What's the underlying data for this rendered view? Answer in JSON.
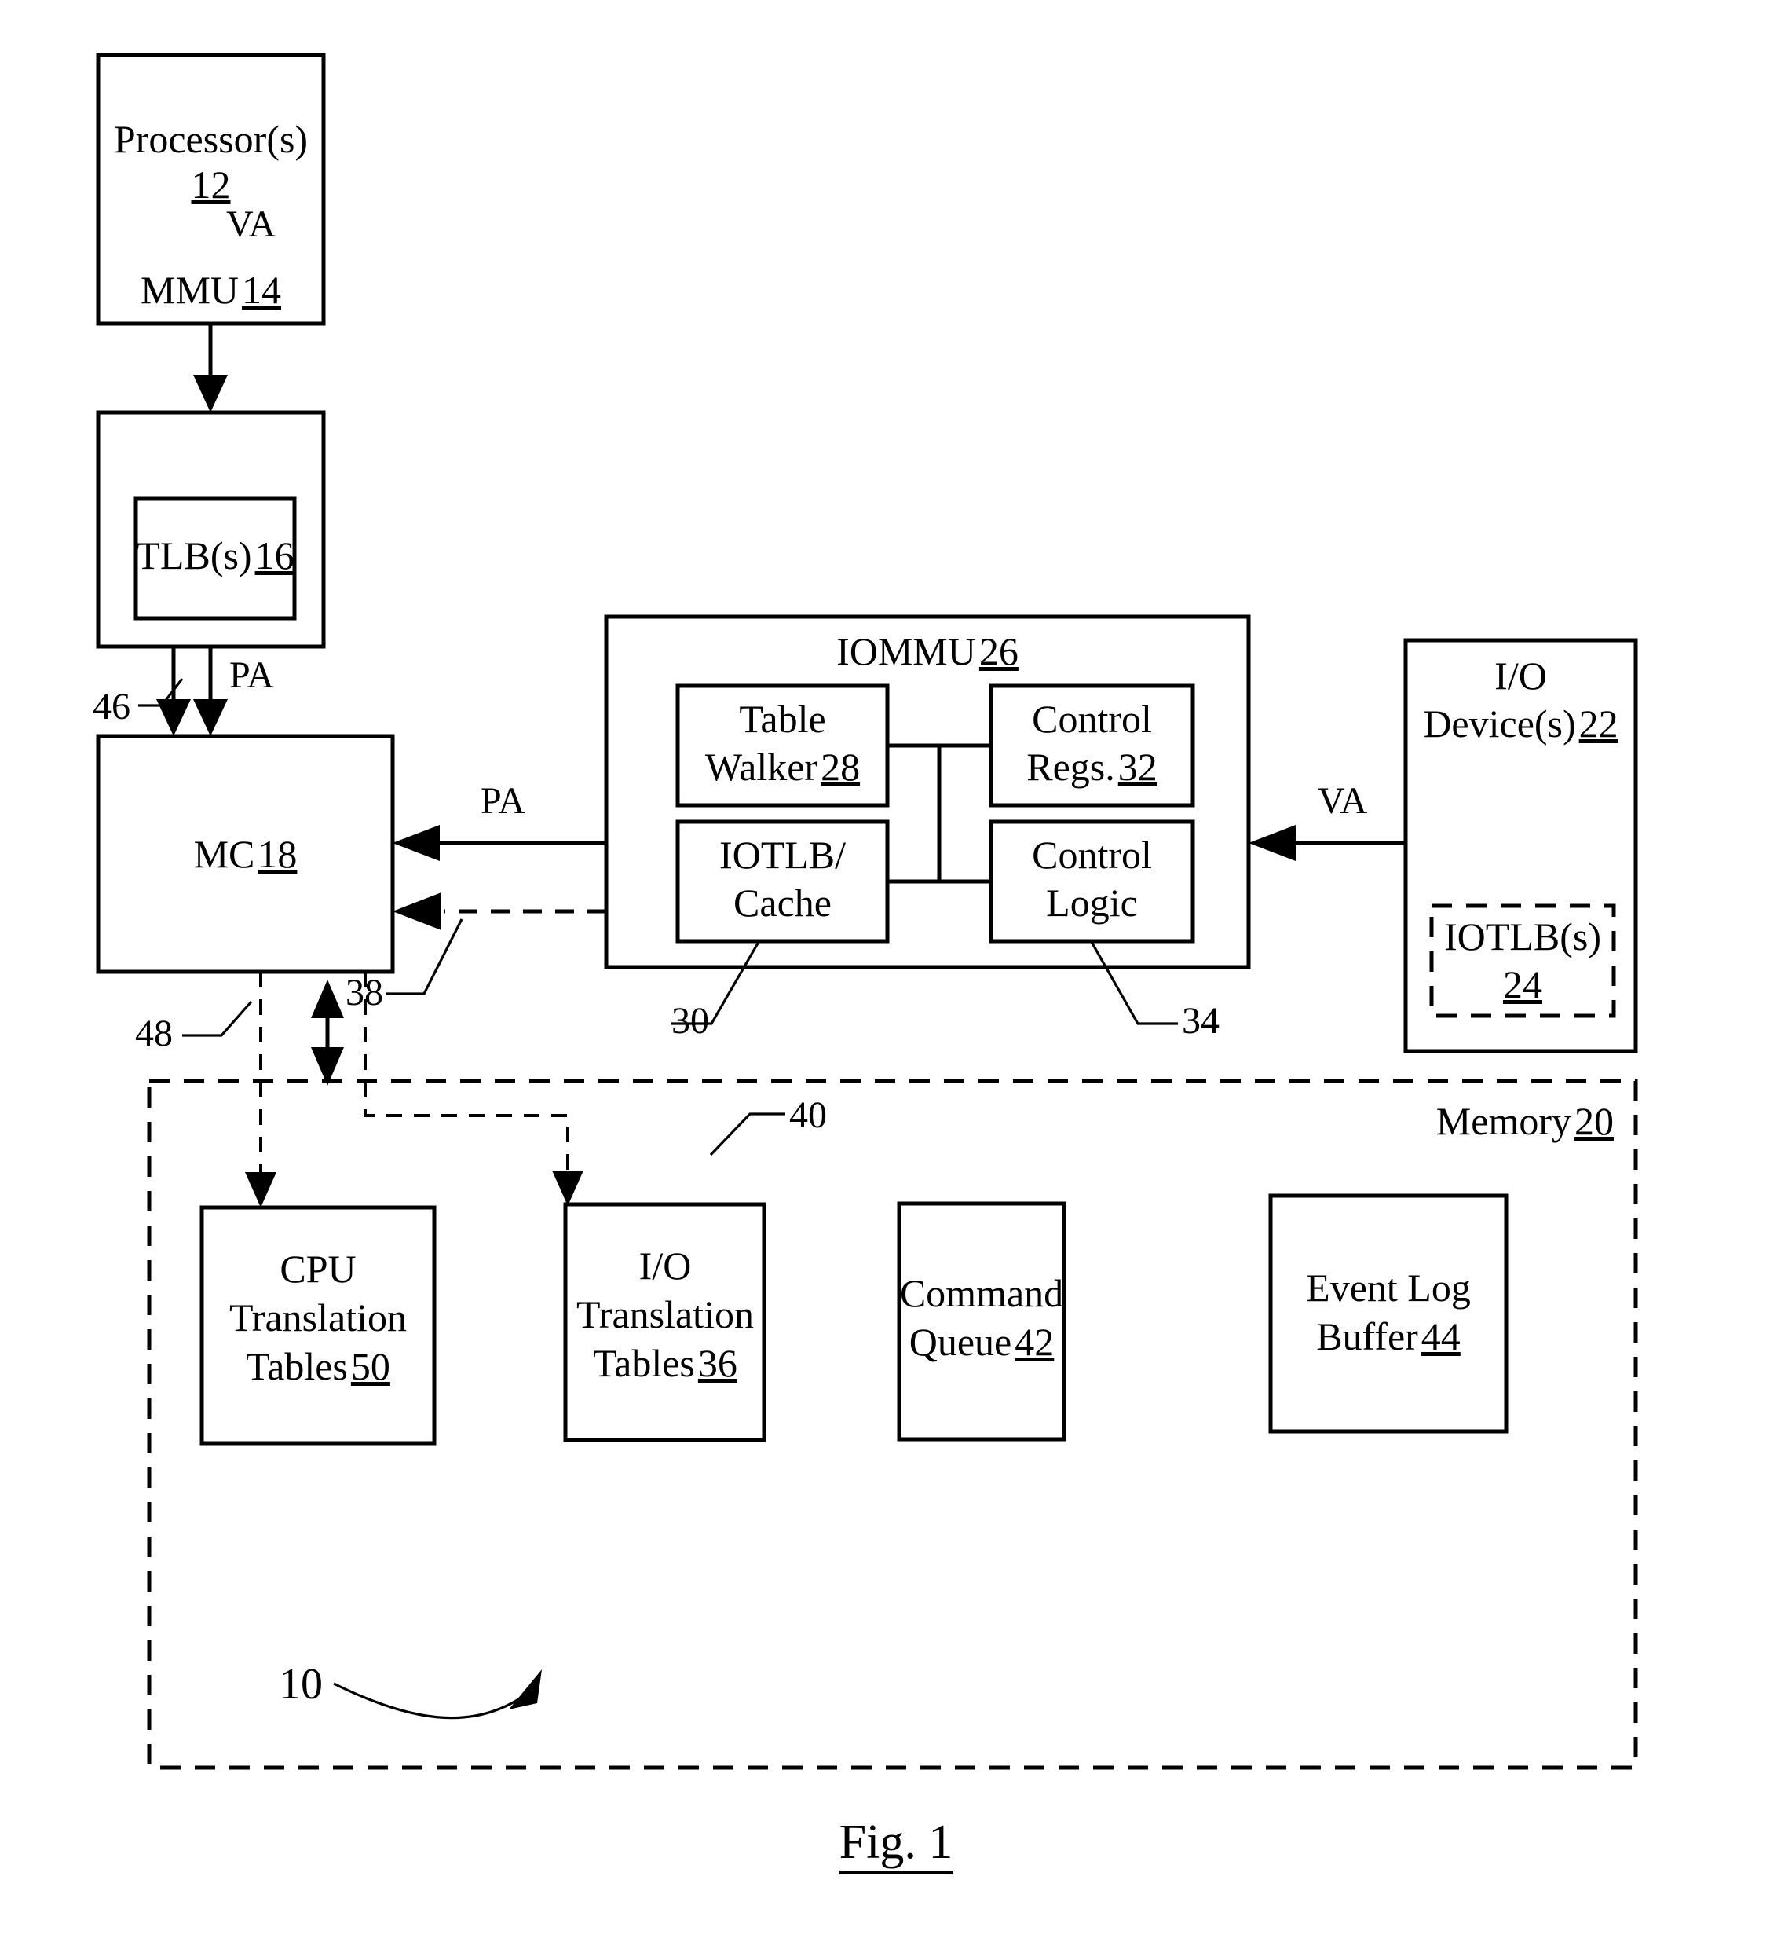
{
  "figure": {
    "caption": "Fig. 1",
    "system_ref": "10"
  },
  "blocks": {
    "processor": {
      "label": "Processor(s)",
      "ref": "12"
    },
    "mmu": {
      "label": "MMU",
      "ref": "14"
    },
    "tlb": {
      "label": "TLB(s)",
      "ref": "16"
    },
    "mc": {
      "label": "MC",
      "ref": "18"
    },
    "iommu": {
      "label": "IOMMU",
      "ref": "26"
    },
    "table_walker": {
      "label_line1": "Table",
      "label_line2": "Walker",
      "ref": "28"
    },
    "iotlb_cache": {
      "label_line1": "IOTLB/",
      "label_line2": "Cache",
      "ref": "30"
    },
    "control_regs": {
      "label_line1": "Control",
      "label_line2": "Regs.",
      "ref": "32"
    },
    "control_logic": {
      "label_line1": "Control",
      "label_line2": "Logic",
      "ref": "34"
    },
    "io_device": {
      "label_line1": "I/O",
      "label_line2": "Device(s)",
      "ref": "22"
    },
    "io_tlbs": {
      "label": "IOTLB(s)",
      "ref": "24"
    },
    "memory": {
      "label": "Memory",
      "ref": "20"
    },
    "cpu_tables": {
      "label_line1": "CPU",
      "label_line2": "Translation",
      "label_line3": "Tables",
      "ref": "50"
    },
    "io_tables": {
      "label_line1": "I/O",
      "label_line2": "Translation",
      "label_line3": "Tables",
      "ref": "36"
    },
    "command_queue": {
      "label_line1": "Command",
      "label_line2": "Queue",
      "ref": "42"
    },
    "event_log": {
      "label_line1": "Event Log",
      "label_line2": "Buffer",
      "ref": "44"
    }
  },
  "signals": {
    "va_processor_mmu": "VA",
    "pa_mmu_mc": "PA",
    "pa_iommu_mc": "PA",
    "va_device_iommu": "VA"
  },
  "ref_callouts": {
    "bus_46": "46",
    "bus_48": "48",
    "link_38": "38",
    "link_40": "40",
    "iotlb_cache_30": "30",
    "control_logic_34": "34"
  }
}
